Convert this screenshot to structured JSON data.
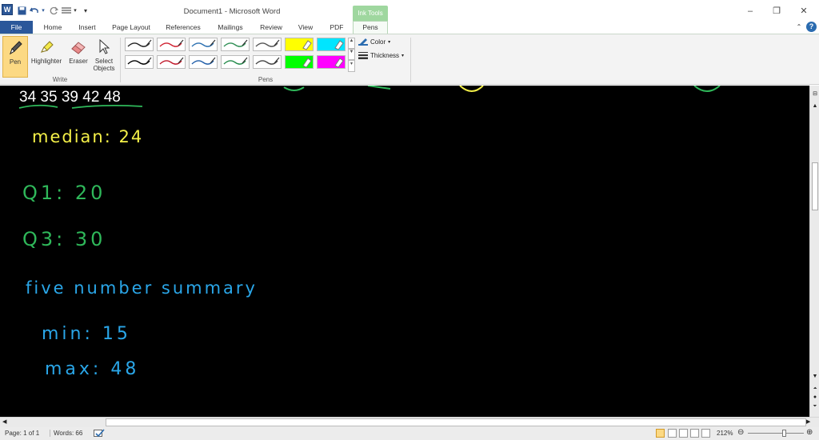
{
  "window": {
    "title": "Document1  -  Microsoft Word",
    "app_icon": "W",
    "contextual_tab_group": "Ink Tools",
    "minimize": "–",
    "restore": "❐",
    "close": "✕"
  },
  "tabs": [
    {
      "label": "File"
    },
    {
      "label": "Home"
    },
    {
      "label": "Insert"
    },
    {
      "label": "Page Layout"
    },
    {
      "label": "References"
    },
    {
      "label": "Mailings"
    },
    {
      "label": "Review"
    },
    {
      "label": "View"
    },
    {
      "label": "PDF"
    },
    {
      "label": "Pens"
    }
  ],
  "ribbon": {
    "write_group": {
      "label": "Write",
      "buttons": [
        {
          "label": "Pen"
        },
        {
          "label": "Highlighter"
        },
        {
          "label": "Eraser"
        },
        {
          "label": "Select\nObjects"
        }
      ]
    },
    "pens_group": {
      "label": "Pens",
      "pen_colors_row1": [
        "#222222",
        "#d02030",
        "#2a6fb0",
        "#2f8f55",
        "#555555",
        "#ffff00",
        "#00e5ff"
      ],
      "pen_colors_row2": [
        "#000000",
        "#c0182a",
        "#1f5da8",
        "#238a4a",
        "#444444",
        "#00ff00",
        "#ff00ff"
      ]
    },
    "color_label": "Color",
    "thickness_label": "Thickness"
  },
  "ink": {
    "numbers": [
      "34",
      "35",
      "39",
      "42",
      "48"
    ],
    "median": "median: 24",
    "q1": "Q1: 20",
    "q3": "Q3: 30",
    "five_number_summary": "five number summary",
    "min": "min: 15",
    "max": "max: 48",
    "colors": {
      "median": "#f4f048",
      "quartiles": "#2fb85a",
      "summary": "#2aa6e8",
      "numbers": "#ffffff"
    }
  },
  "status": {
    "page": "Page: 1 of 1",
    "words": "Words: 66",
    "zoom": "212%"
  }
}
